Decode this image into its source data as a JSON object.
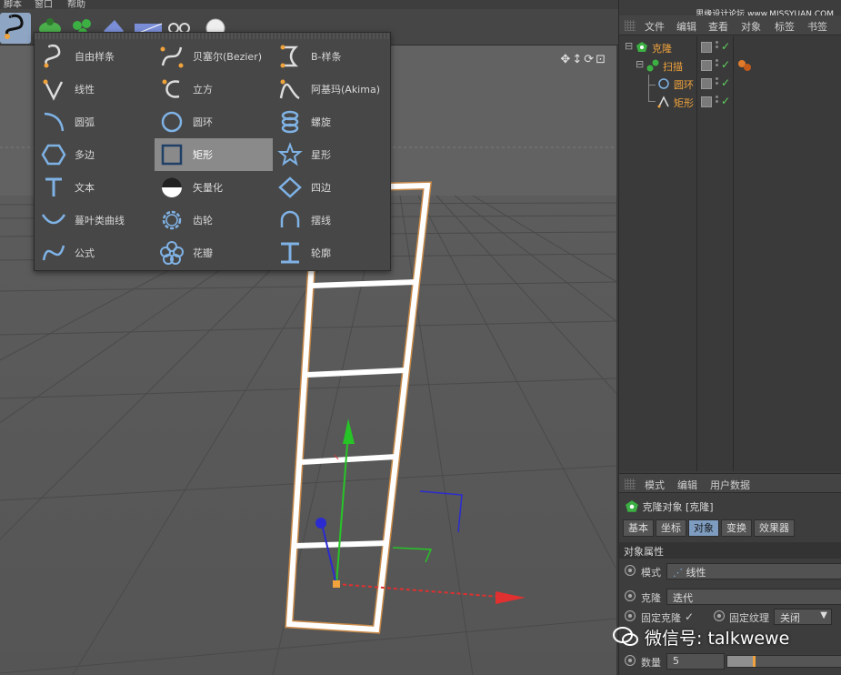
{
  "menubar": {
    "items": [
      "脚本",
      "窗口",
      "帮助"
    ]
  },
  "spline_menu": {
    "columns": [
      [
        {
          "label": "自由样条",
          "icon": "freehand-spline-icon"
        },
        {
          "label": "线性",
          "icon": "linear-spline-icon"
        },
        {
          "label": "圆弧",
          "icon": "arc-icon"
        },
        {
          "label": "多边",
          "icon": "ngon-icon"
        },
        {
          "label": "文本",
          "icon": "text-icon"
        },
        {
          "label": "蔓叶类曲线",
          "icon": "cissoid-icon"
        },
        {
          "label": "公式",
          "icon": "formula-icon"
        }
      ],
      [
        {
          "label": "贝塞尔(Bezier)",
          "icon": "bezier-spline-icon"
        },
        {
          "label": "立方",
          "icon": "cubic-spline-icon"
        },
        {
          "label": "圆环",
          "icon": "circle-icon"
        },
        {
          "label": "矩形",
          "icon": "rectangle-icon",
          "active": true
        },
        {
          "label": "矢量化",
          "icon": "vectorizer-icon"
        },
        {
          "label": "齿轮",
          "icon": "cogwheel-icon"
        },
        {
          "label": "花瓣",
          "icon": "flower-icon"
        }
      ],
      [
        {
          "label": "B-样条",
          "icon": "b-spline-icon"
        },
        {
          "label": "阿基玛(Akima)",
          "icon": "akima-spline-icon"
        },
        {
          "label": "螺旋",
          "icon": "helix-icon"
        },
        {
          "label": "星形",
          "icon": "star-icon"
        },
        {
          "label": "四边",
          "icon": "four-side-icon"
        },
        {
          "label": "摆线",
          "icon": "cycloid-icon"
        },
        {
          "label": "轮廓",
          "icon": "profile-icon"
        }
      ]
    ]
  },
  "object_manager": {
    "menu": [
      "文件",
      "编辑",
      "查看",
      "对象",
      "标签",
      "书签"
    ],
    "objects": [
      {
        "name": "克隆",
        "icon": "cloner-icon"
      },
      {
        "name": "扫描",
        "icon": "sweep-icon"
      },
      {
        "name": "圆环",
        "icon": "circle-icon"
      },
      {
        "name": "矩形",
        "icon": "rectangle-spline-icon"
      }
    ]
  },
  "watermark": "思缘设计论坛 www.MISSYUAN.COM",
  "attribute_manager": {
    "menu": [
      "模式",
      "编辑",
      "用户数据"
    ],
    "title": "克隆对象 [克隆]",
    "tabs": [
      {
        "label": "基本"
      },
      {
        "label": "坐标"
      },
      {
        "label": "对象",
        "active": true
      },
      {
        "label": "变换"
      },
      {
        "label": "效果器"
      }
    ],
    "section": "对象属性",
    "mode_label": "模式",
    "mode_value": "线性",
    "clone_label": "克隆",
    "clone_value": "迭代",
    "fix_clone_label": "固定克隆",
    "fix_clone_check": "✓",
    "fix_texture_label": "固定纹理",
    "fix_texture_value": "关闭",
    "count_label": "数量",
    "count_value": "5",
    "count_slider": 0.22
  },
  "wechat": {
    "text": "微信号: talkwewe"
  },
  "colors": {
    "accent": "#f0a33c",
    "active_tab": "#7d9cc0",
    "check": "#5fd35f"
  }
}
